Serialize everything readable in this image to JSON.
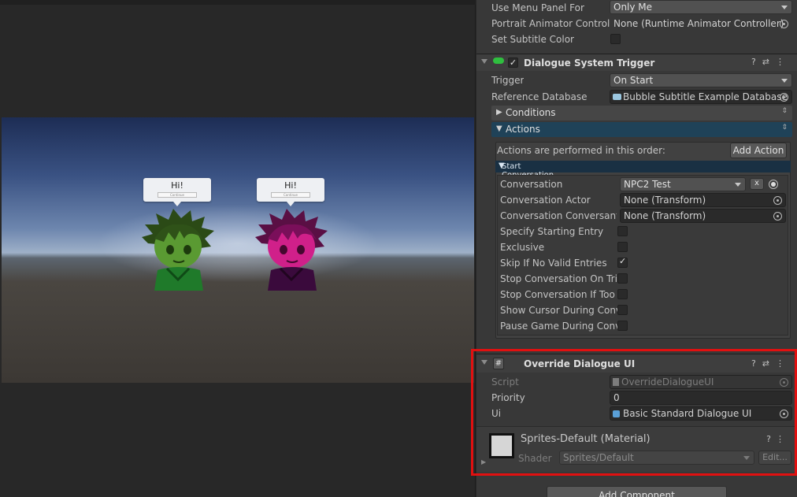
{
  "scene": {
    "bubbles": [
      {
        "text": "Hi!",
        "name": "Continue"
      },
      {
        "text": "Hi!",
        "name": "Continue"
      }
    ]
  },
  "inspector": {
    "top_rows": [
      {
        "label": "Use Menu Panel For",
        "value": "Only Me",
        "type": "dropdown"
      },
      {
        "label": "Portrait Animator Controlle",
        "value": "None (Runtime Animator Controller)",
        "type": "object"
      },
      {
        "label": "Set Subtitle Color",
        "type": "checkbox",
        "checked": false
      }
    ],
    "trigger_component": {
      "title": "Dialogue System Trigger",
      "trigger_label": "Trigger",
      "trigger_value": "On Start",
      "ref_db_label": "Reference Database",
      "ref_db_value": "Bubble Subtitle Example Database",
      "conditions_label": "Conditions",
      "actions_label": "Actions",
      "actions_order_text": "Actions are performed in this order:",
      "add_action_label": "Add Action",
      "start_conversation_label": "Start Conversation",
      "conversation_label": "Conversation",
      "conversation_value": "NPC2 Test",
      "clear_label": "x",
      "fields": [
        {
          "label": "Conversation Actor",
          "value": "None (Transform)",
          "type": "object"
        },
        {
          "label": "Conversation Conversant",
          "value": "None (Transform)",
          "type": "object"
        },
        {
          "label": "Specify Starting Entry",
          "type": "checkbox",
          "checked": false
        },
        {
          "label": "Exclusive",
          "type": "checkbox",
          "checked": false
        },
        {
          "label": "Skip If No Valid Entries",
          "type": "checkbox",
          "checked": true
        },
        {
          "label": "Stop Conversation On Trig",
          "type": "checkbox",
          "checked": false
        },
        {
          "label": "Stop Conversation If Too F",
          "type": "checkbox",
          "checked": false
        },
        {
          "label": "Show Cursor During Conve",
          "type": "checkbox",
          "checked": false
        },
        {
          "label": "Pause Game During Conve",
          "type": "checkbox",
          "checked": false
        }
      ]
    },
    "override_component": {
      "title": "Override Dialogue UI",
      "script_label": "Script",
      "script_value": "OverrideDialogueUI",
      "priority_label": "Priority",
      "priority_value": "0",
      "ui_label": "Ui",
      "ui_value": "Basic Standard Dialogue UI"
    },
    "material": {
      "title": "Sprites-Default (Material)",
      "shader_label": "Shader",
      "shader_value": "Sprites/Default",
      "edit_label": "Edit..."
    },
    "add_component_label": "Add Component"
  },
  "colors": {
    "highlight": "#e11010",
    "inspector_bg": "#383838",
    "accent_blue": "#1f4258"
  }
}
